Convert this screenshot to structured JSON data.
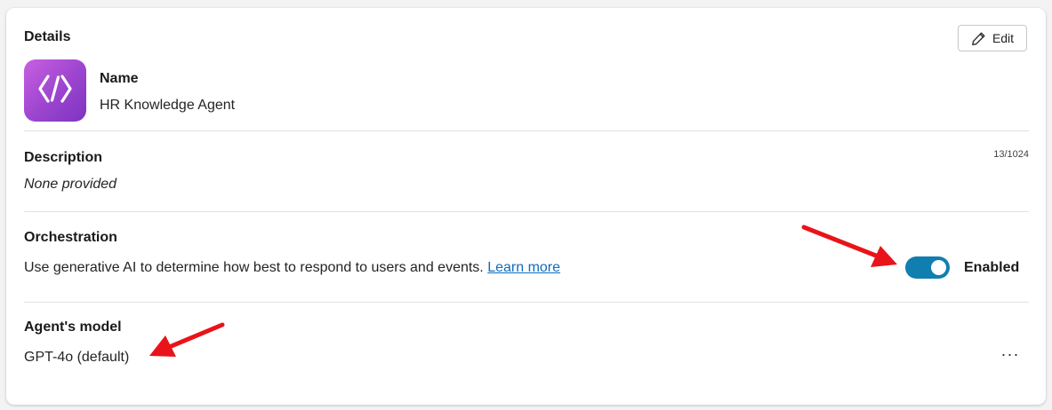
{
  "details": {
    "title": "Details",
    "edit_label": "Edit"
  },
  "name": {
    "label": "Name",
    "value": "HR Knowledge Agent"
  },
  "description": {
    "label": "Description",
    "value": "None provided",
    "char_count": "13/1024"
  },
  "orchestration": {
    "label": "Orchestration",
    "text": "Use generative AI to determine how best to respond to users and events.",
    "link_text": "Learn more",
    "toggle_label": "Enabled",
    "toggle_on": true
  },
  "model": {
    "label": "Agent's model",
    "value": "GPT-4o (default)",
    "more_label": "···"
  },
  "colors": {
    "accent": "#117eb0",
    "annotation_arrow": "#e8141a",
    "icon_gradient_start": "#c860e0",
    "icon_gradient_end": "#7c35c0"
  },
  "icons": {
    "edit": "pencil-icon",
    "agent": "code-brackets-icon"
  }
}
